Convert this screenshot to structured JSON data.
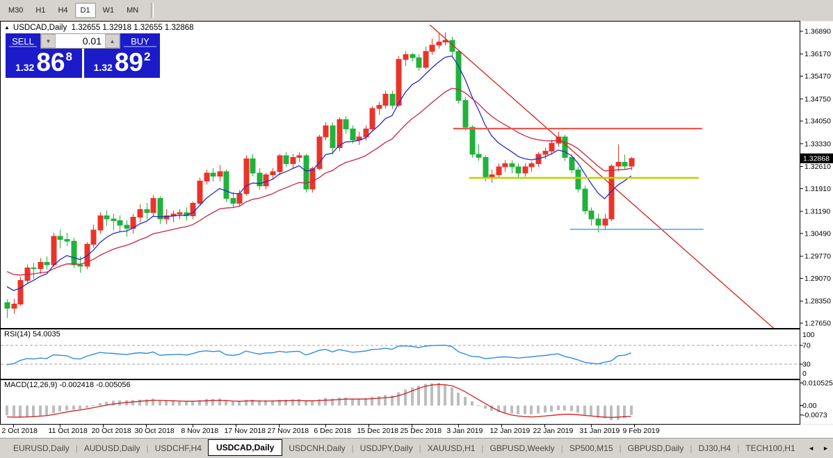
{
  "toolbar": {
    "timeframes": [
      {
        "label": "M30",
        "active": false
      },
      {
        "label": "H1",
        "active": false
      },
      {
        "label": "H4",
        "active": false
      },
      {
        "label": "D1",
        "active": true
      },
      {
        "label": "W1",
        "active": false
      },
      {
        "label": "MN",
        "active": false
      }
    ]
  },
  "chart": {
    "header": {
      "collapse_icon": "▲",
      "symbol_label": "USDCAD,Daily",
      "ohlc": "1.32655 1.32918 1.32655 1.32868"
    },
    "trade_panel": {
      "sell_label": "SELL",
      "buy_label": "BUY",
      "volume": "0.01",
      "spin_down_icon": "▼",
      "spin_up_icon": "▲",
      "bid_small": "1.32",
      "bid_big": "86",
      "bid_sup": "8",
      "ask_small": "1.32",
      "ask_big": "89",
      "ask_sup": "2"
    }
  },
  "chart_data": {
    "type": "candlestick",
    "symbol": "USDCAD",
    "timeframe": "Daily",
    "title": "USDCAD,Daily",
    "price_axis": {
      "ticks": [
        "1.36890",
        "1.36170",
        "1.35470",
        "1.34750",
        "1.34050",
        "1.33330",
        "1.32610",
        "1.31910",
        "1.31190",
        "1.30490",
        "1.29770",
        "1.29070",
        "1.28350",
        "1.27650"
      ],
      "current": "1.32868"
    },
    "x_axis_labels": [
      {
        "label": "2 Oct 2018",
        "i": 1
      },
      {
        "label": "11 Oct 2018",
        "i": 8
      },
      {
        "label": "20 Oct 2018",
        "i": 14.5
      },
      {
        "label": "30 Oct 2018",
        "i": 21
      },
      {
        "label": "8 Nov 2018",
        "i": 28
      },
      {
        "label": "17 Nov 2018",
        "i": 34.5
      },
      {
        "label": "27 Nov 2018",
        "i": 41
      },
      {
        "label": "6 Dec 2018",
        "i": 48
      },
      {
        "label": "15 Dec 2018",
        "i": 54.5
      },
      {
        "label": "25 Dec 2018",
        "i": 61
      },
      {
        "label": "3 Jan 2019",
        "i": 68
      },
      {
        "label": "12 Jan 2019",
        "i": 74.5
      },
      {
        "label": "22 Jan 2019",
        "i": 81
      },
      {
        "label": "31 Jan 2019",
        "i": 88
      },
      {
        "label": "9 Feb 2019",
        "i": 94.5
      }
    ],
    "candles": [
      [
        1.283,
        1.2841,
        1.2782,
        1.2812
      ],
      [
        1.2812,
        1.2842,
        1.2795,
        1.2826
      ],
      [
        1.2826,
        1.2912,
        1.282,
        1.29
      ],
      [
        1.29,
        1.2951,
        1.2889,
        1.294
      ],
      [
        1.294,
        1.2956,
        1.2905,
        1.2938
      ],
      [
        1.2938,
        1.2971,
        1.2921,
        1.2958
      ],
      [
        1.2958,
        1.2976,
        1.2934,
        1.295
      ],
      [
        1.295,
        1.3051,
        1.2944,
        1.304
      ],
      [
        1.304,
        1.3061,
        1.3001,
        1.303
      ],
      [
        1.303,
        1.3051,
        1.3009,
        1.3025
      ],
      [
        1.3025,
        1.3036,
        1.294,
        1.295
      ],
      [
        1.295,
        1.2976,
        1.2924,
        1.2945
      ],
      [
        1.2945,
        1.3021,
        1.2936,
        1.3015
      ],
      [
        1.3015,
        1.3076,
        1.3004,
        1.306
      ],
      [
        1.306,
        1.3116,
        1.3049,
        1.3105
      ],
      [
        1.3105,
        1.3121,
        1.3074,
        1.3095
      ],
      [
        1.3095,
        1.3111,
        1.3059,
        1.309
      ],
      [
        1.309,
        1.3106,
        1.3054,
        1.3075
      ],
      [
        1.3075,
        1.3091,
        1.3039,
        1.3065
      ],
      [
        1.3065,
        1.3111,
        1.3049,
        1.31
      ],
      [
        1.31,
        1.3141,
        1.3084,
        1.3125
      ],
      [
        1.3125,
        1.3146,
        1.3094,
        1.3115
      ],
      [
        1.3115,
        1.3171,
        1.3104,
        1.316
      ],
      [
        1.316,
        1.3166,
        1.3079,
        1.3095
      ],
      [
        1.3095,
        1.3126,
        1.3079,
        1.3105
      ],
      [
        1.3105,
        1.3121,
        1.3084,
        1.311
      ],
      [
        1.311,
        1.3126,
        1.3094,
        1.3115
      ],
      [
        1.3115,
        1.3131,
        1.3089,
        1.3105
      ],
      [
        1.3105,
        1.3151,
        1.3094,
        1.3145
      ],
      [
        1.3145,
        1.3226,
        1.3139,
        1.3215
      ],
      [
        1.3215,
        1.3251,
        1.3204,
        1.324
      ],
      [
        1.324,
        1.3256,
        1.3214,
        1.323
      ],
      [
        1.323,
        1.3266,
        1.3214,
        1.3245
      ],
      [
        1.3245,
        1.3251,
        1.3149,
        1.316
      ],
      [
        1.316,
        1.3181,
        1.3129,
        1.3145
      ],
      [
        1.3145,
        1.3186,
        1.3134,
        1.3175
      ],
      [
        1.3175,
        1.3296,
        1.3169,
        1.3285
      ],
      [
        1.3285,
        1.3301,
        1.3229,
        1.324
      ],
      [
        1.324,
        1.3256,
        1.3189,
        1.32
      ],
      [
        1.32,
        1.3241,
        1.3189,
        1.3235
      ],
      [
        1.3235,
        1.3256,
        1.3219,
        1.3245
      ],
      [
        1.3245,
        1.3301,
        1.3234,
        1.3295
      ],
      [
        1.3295,
        1.3306,
        1.3259,
        1.327
      ],
      [
        1.327,
        1.3301,
        1.3254,
        1.329
      ],
      [
        1.329,
        1.3306,
        1.3274,
        1.3295
      ],
      [
        1.3295,
        1.3301,
        1.3179,
        1.319
      ],
      [
        1.319,
        1.3261,
        1.3179,
        1.3255
      ],
      [
        1.3255,
        1.3361,
        1.3249,
        1.3355
      ],
      [
        1.3355,
        1.3401,
        1.3344,
        1.339
      ],
      [
        1.339,
        1.3401,
        1.3299,
        1.332
      ],
      [
        1.332,
        1.3416,
        1.3309,
        1.341
      ],
      [
        1.341,
        1.3421,
        1.3364,
        1.338
      ],
      [
        1.338,
        1.3391,
        1.3334,
        1.3345
      ],
      [
        1.3345,
        1.3371,
        1.3329,
        1.3355
      ],
      [
        1.3355,
        1.3391,
        1.3344,
        1.338
      ],
      [
        1.338,
        1.3451,
        1.3374,
        1.3445
      ],
      [
        1.3445,
        1.3466,
        1.3424,
        1.3455
      ],
      [
        1.3455,
        1.3501,
        1.3444,
        1.349
      ],
      [
        1.349,
        1.3501,
        1.3444,
        1.3455
      ],
      [
        1.3455,
        1.3611,
        1.3449,
        1.36
      ],
      [
        1.36,
        1.3626,
        1.3579,
        1.3615
      ],
      [
        1.3615,
        1.3621,
        1.3594,
        1.3605
      ],
      [
        1.3605,
        1.3616,
        1.3564,
        1.3575
      ],
      [
        1.3575,
        1.3641,
        1.3569,
        1.3625
      ],
      [
        1.3625,
        1.3666,
        1.3614,
        1.3645
      ],
      [
        1.3645,
        1.3681,
        1.3634,
        1.3655
      ],
      [
        1.3655,
        1.3686,
        1.3644,
        1.366
      ],
      [
        1.366,
        1.3671,
        1.3609,
        1.3625
      ],
      [
        1.3625,
        1.3631,
        1.3459,
        1.347
      ],
      [
        1.347,
        1.3481,
        1.3374,
        1.3385
      ],
      [
        1.3385,
        1.3391,
        1.3289,
        1.33
      ],
      [
        1.33,
        1.3331,
        1.3279,
        1.329
      ],
      [
        1.329,
        1.3296,
        1.3214,
        1.3225
      ],
      [
        1.3225,
        1.3251,
        1.3209,
        1.3235
      ],
      [
        1.3235,
        1.3271,
        1.3224,
        1.326
      ],
      [
        1.326,
        1.3281,
        1.3244,
        1.327
      ],
      [
        1.327,
        1.3281,
        1.3239,
        1.326
      ],
      [
        1.326,
        1.3271,
        1.3224,
        1.324
      ],
      [
        1.324,
        1.3271,
        1.3229,
        1.326
      ],
      [
        1.326,
        1.3276,
        1.3244,
        1.327
      ],
      [
        1.327,
        1.3306,
        1.3259,
        1.33
      ],
      [
        1.33,
        1.3321,
        1.3284,
        1.331
      ],
      [
        1.331,
        1.3346,
        1.3299,
        1.3335
      ],
      [
        1.3335,
        1.3371,
        1.3324,
        1.3355
      ],
      [
        1.3355,
        1.3361,
        1.3279,
        1.329
      ],
      [
        1.329,
        1.3301,
        1.3239,
        1.325
      ],
      [
        1.325,
        1.3261,
        1.3179,
        1.319
      ],
      [
        1.319,
        1.3201,
        1.3109,
        1.312
      ],
      [
        1.312,
        1.3131,
        1.3074,
        1.3095
      ],
      [
        1.3095,
        1.3111,
        1.3052,
        1.3075
      ],
      [
        1.3075,
        1.3111,
        1.3059,
        1.3095
      ],
      [
        1.3095,
        1.3268,
        1.3087,
        1.3262
      ],
      [
        1.3262,
        1.333,
        1.3246,
        1.3274
      ],
      [
        1.3274,
        1.3299,
        1.3252,
        1.3262
      ],
      [
        1.3262,
        1.3292,
        1.3249,
        1.32868
      ]
    ],
    "colors": {
      "up": "#e8352a",
      "down": "#22b13c",
      "ma_fast": "#2929c8",
      "ma_slow": "#c92348",
      "rsi": "#2f8be0",
      "macd_hist": "#bdbdbd",
      "macd_signal": "#d01f1f",
      "hline_red": "#f0564a",
      "hline_yellow": "#bed300",
      "hline_blue": "#4aa3e8",
      "trendline": "#cf2218"
    },
    "ma_fast": {
      "period": 8,
      "seed": 1.29
    },
    "ma_slow": {
      "period": 21,
      "seed": 1.294
    },
    "hlines": [
      {
        "name": "resistance-red",
        "price": 1.3381,
        "i1": 67.2,
        "i2": 104.7,
        "color_key": "hline_red",
        "width": 2.2
      },
      {
        "name": "support-yellow",
        "price": 1.3225,
        "i1": 69.6,
        "i2": 104.2,
        "color_key": "hline_yellow",
        "width": 2.6
      },
      {
        "name": "support-blue",
        "price": 1.3062,
        "i1": 84.8,
        "i2": 104.9,
        "color_key": "hline_blue",
        "width": 1.4
      }
    ],
    "trendline": {
      "i1": 63.7,
      "p1": 1.3709,
      "i2": 115.5,
      "p2": 1.2748,
      "width": 1.3
    },
    "rsi": {
      "label": "RSI(14) 54.0035",
      "levels": [
        70,
        30
      ],
      "axis_labels": [
        "100",
        "70",
        "30",
        "0"
      ],
      "values": [
        29,
        31,
        38,
        42,
        41,
        43,
        42,
        50,
        49,
        48,
        42,
        41,
        47,
        51,
        55,
        53.5,
        53,
        51.5,
        50.5,
        53,
        54.5,
        53,
        56,
        49,
        50,
        50.5,
        51,
        49.5,
        52.5,
        57,
        58.5,
        57,
        58,
        50,
        48.5,
        51,
        58,
        54.5,
        51.5,
        54,
        54.5,
        57.5,
        55.5,
        57,
        57.5,
        49.5,
        54,
        59.5,
        61.5,
        56,
        61,
        58.5,
        55.5,
        56.5,
        58,
        61.5,
        62,
        64,
        61.5,
        68.5,
        69,
        68,
        65.5,
        68.5,
        69.5,
        70,
        70.5,
        67.5,
        56.5,
        51.5,
        46.5,
        46,
        42,
        43,
        45,
        45.5,
        44.5,
        43,
        44.5,
        45.5,
        47.5,
        48.5,
        50.5,
        52,
        46.5,
        43.5,
        39,
        34,
        32,
        30.5,
        34,
        37,
        48,
        49,
        54
      ]
    },
    "macd": {
      "label": "MACD(12,26,9) -0.002418 -0.005056",
      "axis_labels": [
        "0.010525",
        "0.00",
        "-0.0073"
      ],
      "hist": [
        -0.0045,
        -0.005,
        -0.0053,
        -0.0055,
        -0.0054,
        -0.005,
        -0.0045,
        -0.0035,
        -0.0028,
        -0.0022,
        -0.002,
        -0.0018,
        -0.001,
        0.0002,
        0.0012,
        0.0018,
        0.0022,
        0.0024,
        0.0024,
        0.0026,
        0.0028,
        0.0029,
        0.0032,
        0.0026,
        0.0023,
        0.0021,
        0.002,
        0.0019,
        0.0021,
        0.0026,
        0.003,
        0.0031,
        0.0032,
        0.0026,
        0.0021,
        0.0021,
        0.0028,
        0.0028,
        0.0024,
        0.0024,
        0.0025,
        0.0028,
        0.0028,
        0.0029,
        0.003,
        0.0022,
        0.0023,
        0.0029,
        0.0035,
        0.0032,
        0.0037,
        0.0037,
        0.0033,
        0.0032,
        0.0034,
        0.004,
        0.0044,
        0.0048,
        0.0047,
        0.0062,
        0.0075,
        0.0085,
        0.0092,
        0.01,
        0.0104,
        0.0105,
        0.0098,
        0.0085,
        0.006,
        0.004,
        0.002,
        0.0002,
        -0.0015,
        -0.0025,
        -0.0031,
        -0.0035,
        -0.0038,
        -0.0041,
        -0.0041,
        -0.004,
        -0.0037,
        -0.0033,
        -0.0027,
        -0.0021,
        -0.0022,
        -0.0026,
        -0.0033,
        -0.0043,
        -0.0051,
        -0.0057,
        -0.006,
        -0.0068,
        -0.0066,
        -0.0058,
        -0.0044
      ],
      "signal": [
        -0.0053,
        -0.0054,
        -0.0054,
        -0.0053,
        -0.0052,
        -0.005,
        -0.0047,
        -0.0042,
        -0.0036,
        -0.003,
        -0.0025,
        -0.0021,
        -0.0016,
        -0.001,
        -0.0004,
        0.0002,
        0.0007,
        0.0011,
        0.0014,
        0.0017,
        0.002,
        0.0022,
        0.0024,
        0.0024,
        0.0023,
        0.0022,
        0.0021,
        0.002,
        0.002,
        0.0021,
        0.0022,
        0.0023,
        0.0024,
        0.0023,
        0.0021,
        0.002,
        0.0021,
        0.0022,
        0.0021,
        0.0021,
        0.0021,
        0.0022,
        0.0022,
        0.0023,
        0.0023,
        0.0022,
        0.0022,
        0.0023,
        0.0025,
        0.0026,
        0.0028,
        0.003,
        0.003,
        0.003,
        0.003,
        0.0032,
        0.0034,
        0.0037,
        0.0039,
        0.0046,
        0.0056,
        0.0068,
        0.008,
        0.009,
        0.0096,
        0.0098,
        0.0097,
        0.0092,
        0.008,
        0.0064,
        0.0046,
        0.0028,
        0.001,
        -0.0008,
        -0.0024,
        -0.0036,
        -0.0044,
        -0.0049,
        -0.0052,
        -0.0053,
        -0.0052,
        -0.0049,
        -0.0046,
        -0.0043,
        -0.0041,
        -0.0041,
        -0.0043,
        -0.0046,
        -0.0049,
        -0.0052,
        -0.0054,
        -0.0055,
        -0.0054,
        -0.0052,
        -0.005056
      ]
    }
  },
  "tabs": {
    "items": [
      "EURUSD,Daily",
      "AUDUSD,Daily",
      "USDCHF,H4",
      "USDCAD,Daily",
      "USDCNH,Daily",
      "USDJPY,Daily",
      "XAUUSD,H1",
      "GBPUSD,Weekly",
      "SP500,M15",
      "GBPUSD,Daily",
      "DJ30,H4",
      "TECH100,H1"
    ],
    "active_index": 3,
    "scroll_left_icon": "◄",
    "scroll_right_icon": "►"
  }
}
